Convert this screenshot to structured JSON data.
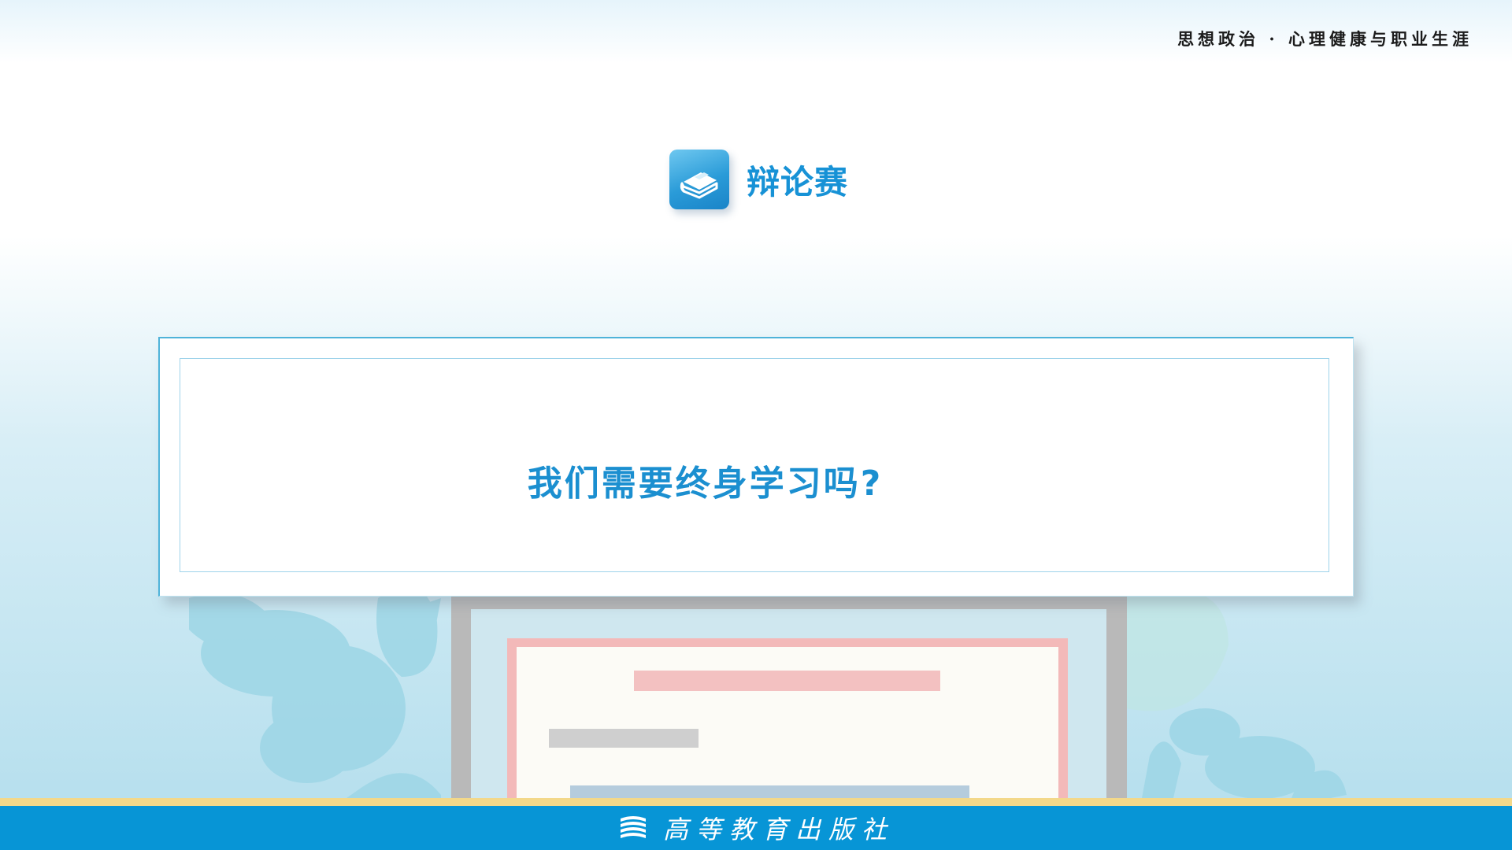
{
  "header": {
    "course_title": "思想政治 · 心理健康与职业生涯"
  },
  "section": {
    "title": "辩论赛",
    "icon": "book-icon"
  },
  "card": {
    "question": "我们需要终身学习吗?"
  },
  "footer": {
    "publisher": "高等教育出版社",
    "logo_icon": "book-stack-icon"
  },
  "colors": {
    "accent": "#1792d6",
    "footer_bg": "#0795d6",
    "footer_stripe": "#f3d88a",
    "card_border": "#4fb3d9"
  }
}
